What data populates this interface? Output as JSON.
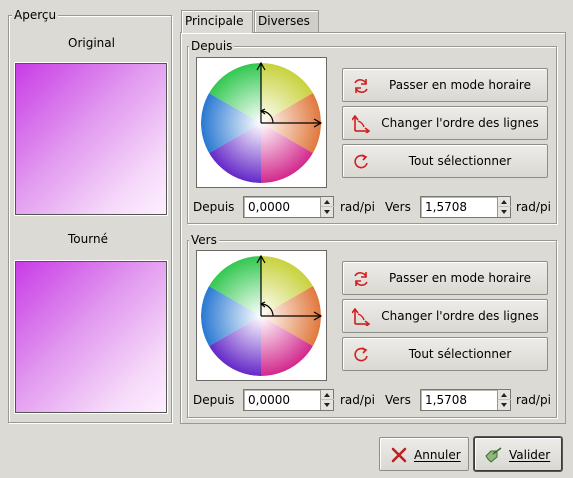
{
  "preview": {
    "title": "Aperçu",
    "original_label": "Original",
    "rotated_label": "Tourné"
  },
  "tabs": [
    {
      "label": "Principale"
    },
    {
      "label": "Diverses"
    }
  ],
  "from_section": {
    "title": "Depuis",
    "buttons": {
      "clockwise": "Passer en mode horaire",
      "swap": "Changer l'ordre des lignes",
      "select_all": "Tout sélectionner"
    },
    "from_label": "Depuis",
    "from_value": "0,0000",
    "from_unit": "rad/pi",
    "to_label": "Vers",
    "to_value": "1,5708",
    "to_unit": "rad/pi"
  },
  "to_section": {
    "title": "Vers",
    "buttons": {
      "clockwise": "Passer en mode horaire",
      "swap": "Changer l'ordre des lignes",
      "select_all": "Tout sélectionner"
    },
    "from_label": "Depuis",
    "from_value": "0,0000",
    "from_unit": "rad/pi",
    "to_label": "Vers",
    "to_value": "1,5708",
    "to_unit": "rad/pi"
  },
  "dialog_buttons": {
    "cancel": "Annuler",
    "ok": "Valider"
  },
  "icons": {
    "clockwise": "clockwise-arrows-icon",
    "swap": "swap-order-icon",
    "select_all": "select-all-icon",
    "cancel": "cancel-x-icon",
    "ok": "ok-check-icon"
  },
  "colors": {
    "window_bg": "#dcdad5",
    "icon_red": "#d21e1e",
    "preview_start": "#c83ce6",
    "preview_end": "#fcefff"
  }
}
